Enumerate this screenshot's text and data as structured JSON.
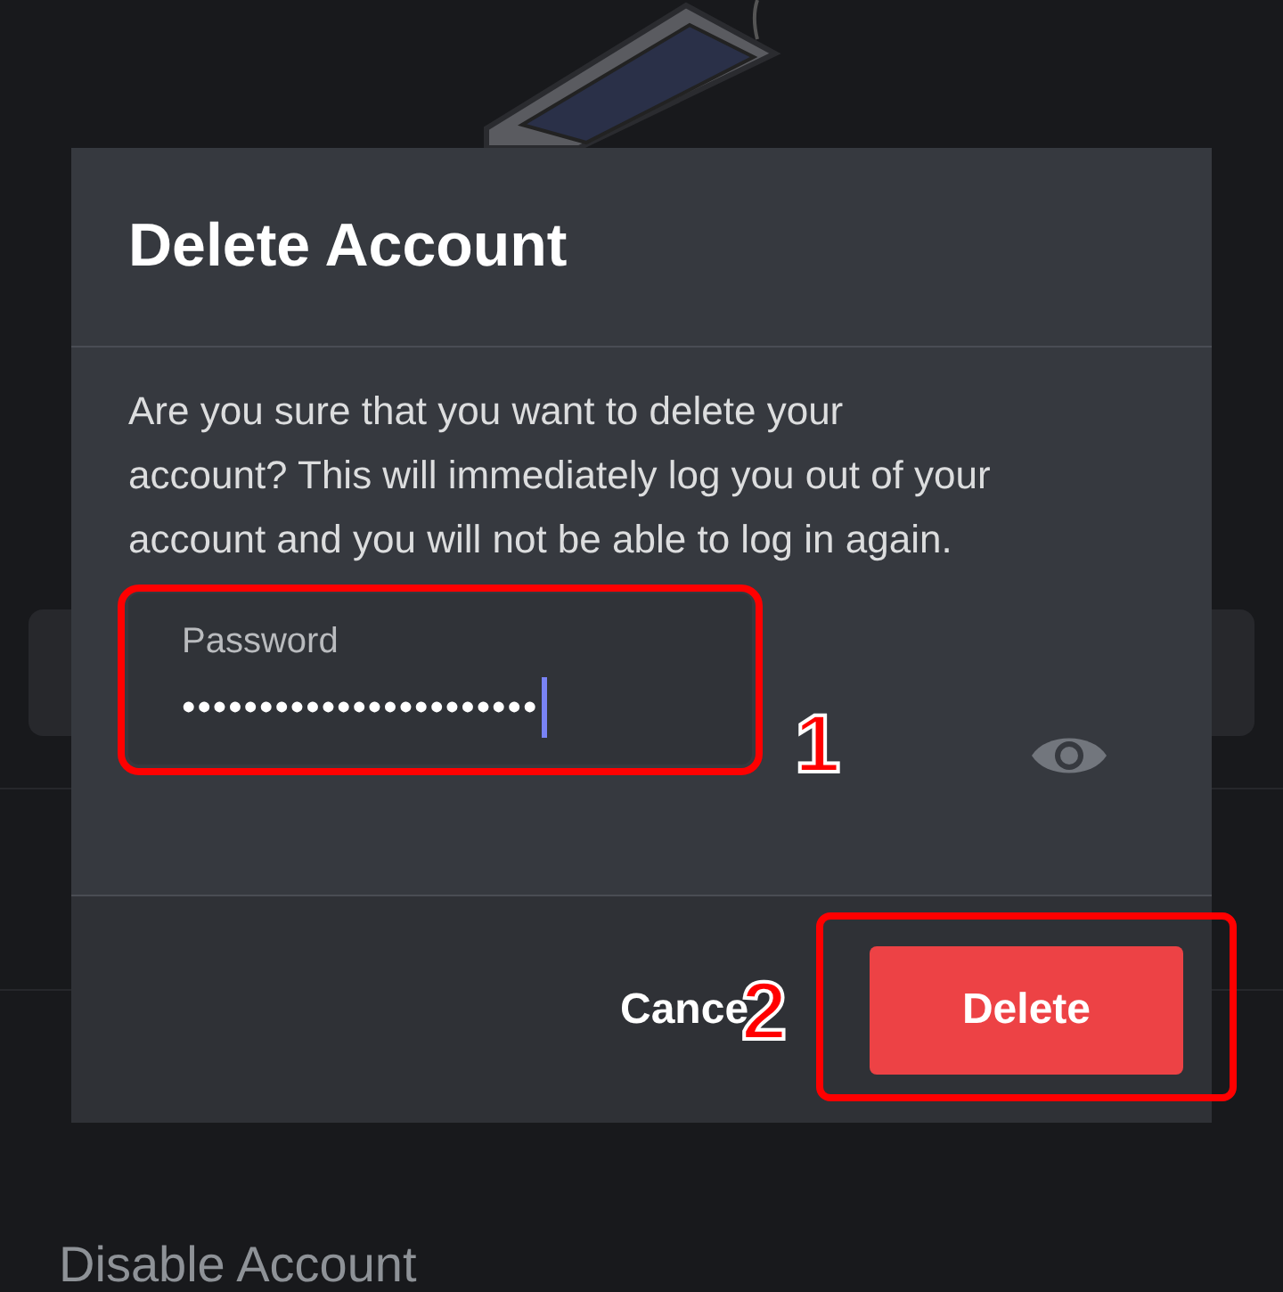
{
  "background": {
    "disable_label": "Disable Account"
  },
  "dialog": {
    "title": "Delete Account",
    "message": "Are you sure that you want to delete your account? This will immediately log you out of your account and you will not be able to log in again.",
    "password": {
      "label": "Password",
      "value": "•••••••••••••••••••••••"
    },
    "cancel": "Cance",
    "delete": "Delete"
  },
  "annotations": [
    {
      "number": "1"
    },
    {
      "number": "2"
    }
  ]
}
